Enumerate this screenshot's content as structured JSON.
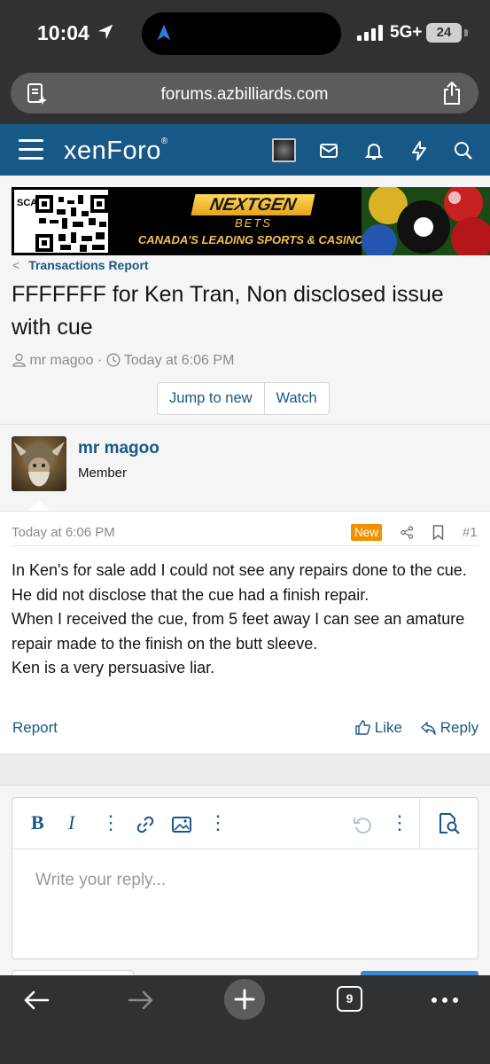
{
  "status_bar": {
    "time": "10:04",
    "network": "5G+",
    "battery": "24"
  },
  "browser": {
    "url": "forums.azbilliards.com"
  },
  "site": {
    "logo": "xenForo",
    "logo_mark": "®"
  },
  "banner": {
    "scan": "SCAN",
    "brand": "NEXTGEN",
    "brand_sub": "BETS",
    "tagline": "CANADA'S LEADING SPORTS & CASINO"
  },
  "breadcrumb": {
    "label": "Transactions Report"
  },
  "thread": {
    "title": "FFFFFFF for Ken Tran, Non disclosed issue with cue",
    "author": "mr magoo",
    "time": "Today at 6:06 PM",
    "jump_label": "Jump to new",
    "watch_label": "Watch"
  },
  "post": {
    "username": "mr magoo",
    "user_title": "Member",
    "date": "Today at 6:06 PM",
    "badge": "New",
    "number": "#1",
    "lines": [
      "In Ken's for sale add I could not see any repairs done to the cue.",
      "He did not disclose that the cue had a finish repair.",
      "When I received the cue, from 5 feet away I can see an amature repair made to the finish on the butt sleeve.",
      "Ken is a very persuasive liar."
    ],
    "report_label": "Report",
    "like_label": "Like",
    "reply_label": "Reply"
  },
  "editor": {
    "bold": "B",
    "italic": "I",
    "placeholder": "Write your reply..."
  },
  "bottom_bar": {
    "tab_count": "9"
  },
  "colors": {
    "brand": "#185886",
    "badge": "#f29100",
    "browser_chrome": "#2f3133"
  }
}
